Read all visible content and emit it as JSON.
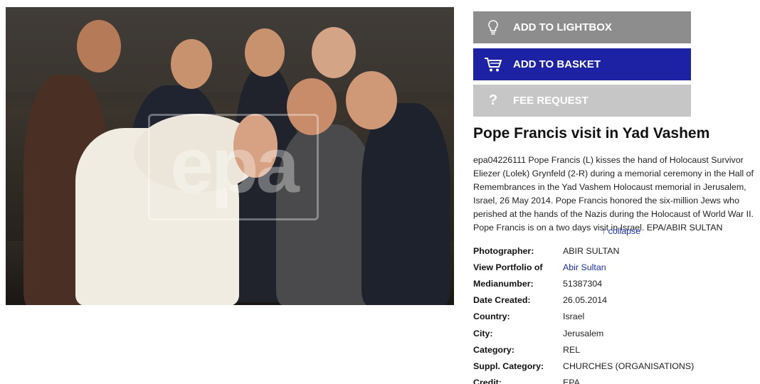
{
  "photo": {
    "watermark": "epa"
  },
  "actions": {
    "lightbox_label": "ADD TO LIGHTBOX",
    "basket_label": "ADD TO BASKET",
    "fee_label": "FEE REQUEST"
  },
  "title": "Pope Francis visit in Yad Vashem",
  "caption": "epa04226111 Pope Francis (L) kisses the hand of Holocaust Survivor Eliezer (Lolek) Grynfeld (2-R) during a memorial ceremony in the Hall of Remembrances in the Yad Vashem Holocaust memorial in Jerusalem, Israel, 26 May 2014. Pope Francis honored the six-million Jews who perished at the hands of the Nazis during the Holocaust of World War II. Pope Francis is on a two days visit in Israel. EPA/ABIR SULTAN",
  "collapse_label": "↑ collapse",
  "meta": [
    {
      "key": "Photographer:",
      "value": "ABIR SULTAN"
    },
    {
      "key": "View Portfolio of",
      "value": "Abir Sultan"
    },
    {
      "key": "Medianumber:",
      "value": "51387304"
    },
    {
      "key": "Date Created:",
      "value": "26.05.2014"
    },
    {
      "key": "Country:",
      "value": "Israel"
    },
    {
      "key": "City:",
      "value": "Jerusalem"
    },
    {
      "key": "Category:",
      "value": "REL"
    },
    {
      "key": "Suppl. Category:",
      "value": "CHURCHES (ORGANISATIONS)"
    },
    {
      "key": "Credit:",
      "value": "EPA"
    }
  ]
}
